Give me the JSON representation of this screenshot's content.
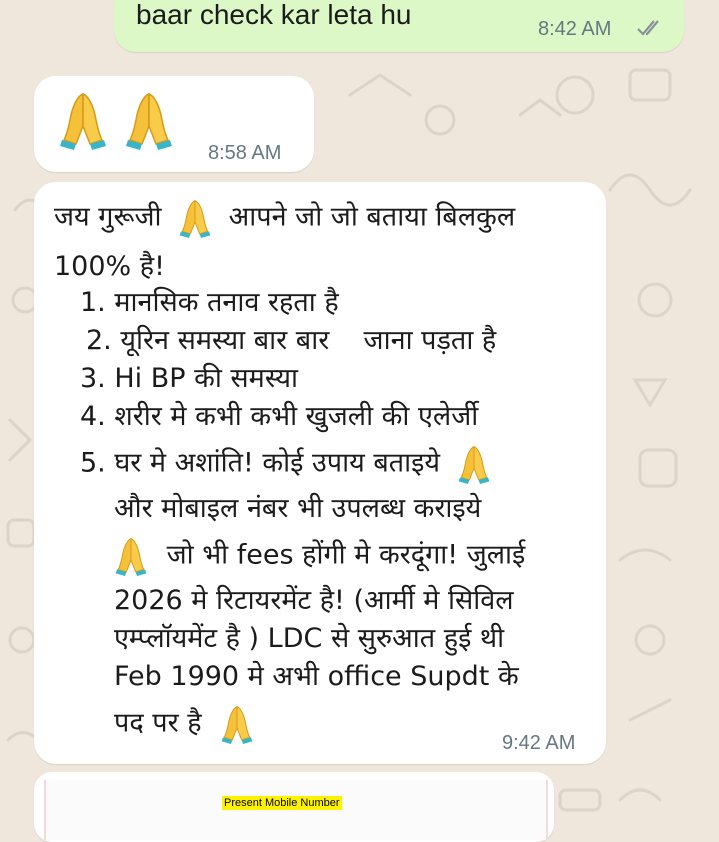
{
  "messages": {
    "m1": {
      "text": "baar check kar leta hu",
      "time": "8:42 AM",
      "status": "read-ticks-icon"
    },
    "m2": {
      "emoji": "🙏 🙏",
      "time": "8:58 AM"
    },
    "m3": {
      "intro_a": "जय गुरूजी",
      "intro_b": "आपने जो जो बताया बिलकुल",
      "intro_c": "100% है!",
      "items": [
        "1. मानसिक तनाव रहता है",
        "2. यूरिन समस्या बार बार    जाना पड़ता है",
        "3. Hi BP की समस्या",
        "4. शरीर मे कभी कभी खुजली की एलेर्जी",
        "5. घर मे अशांति! कोई उपाय बताइये"
      ],
      "cont_1": "और मोबाइल नंबर भी उपलब्ध कराइये",
      "cont_2": "जो भी fees होंगी मे करदूंगा! जुलाई",
      "cont_3": "2026 मे रिटायरमेंट है! (आर्मी मे सिविल",
      "cont_4": "एम्प्लॉयमेंट है ) LDC से सुरुआत हुई थी",
      "cont_5": "Feb 1990 मे अभी office Supdt के",
      "cont_6": "पद पर है",
      "time": "9:42 AM"
    },
    "m4": {
      "highlight": "Present Mobile Number"
    }
  },
  "colors": {
    "chat_bg": "#efe7dc",
    "incoming": "#ffffff",
    "outgoing": "#dcf8c6",
    "time": "#667781",
    "highlight": "#fff200"
  }
}
